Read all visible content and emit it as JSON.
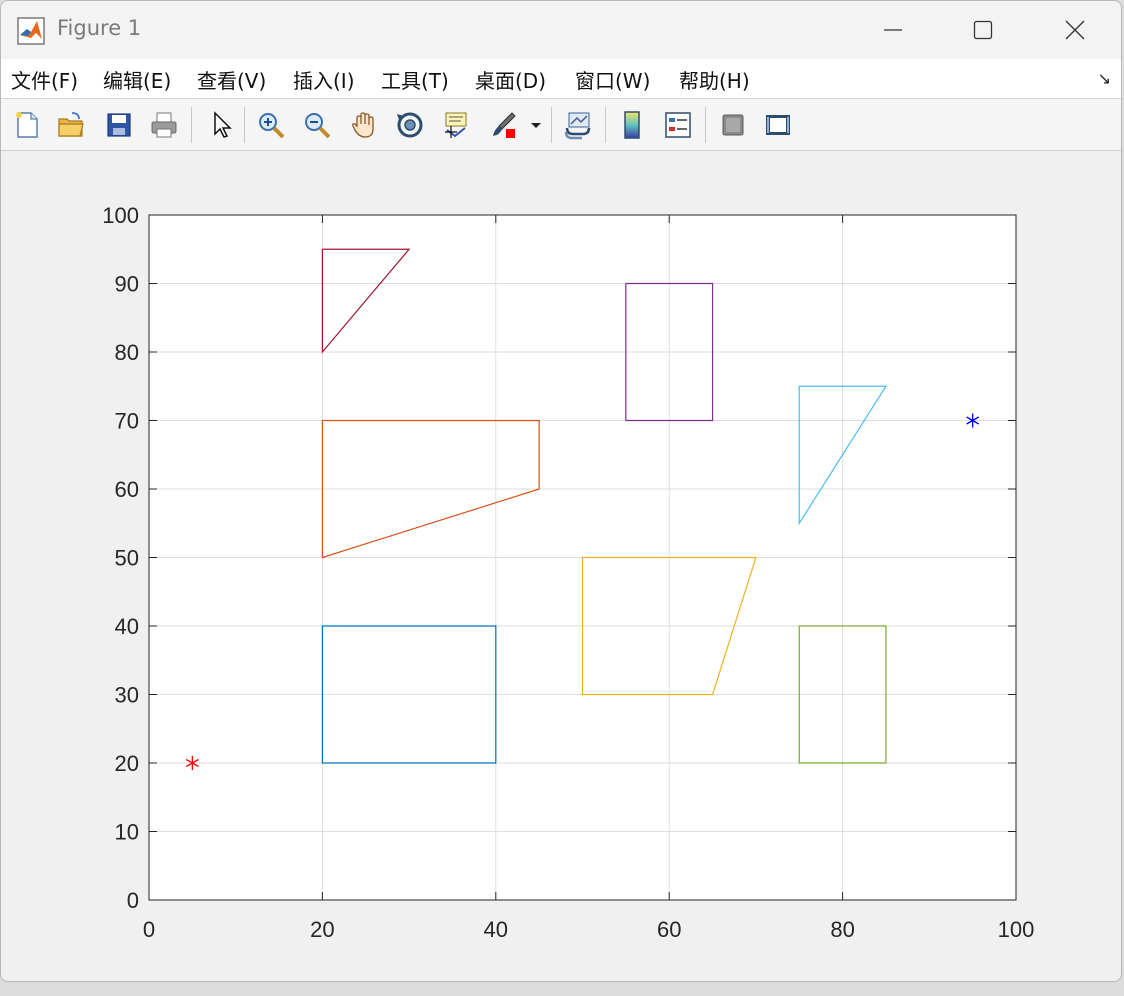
{
  "window": {
    "title": "Figure 1",
    "controls": [
      "minimize",
      "maximize",
      "close"
    ]
  },
  "menu": {
    "items": [
      {
        "label": "文件(F)"
      },
      {
        "label": "编辑(E)"
      },
      {
        "label": "查看(V)"
      },
      {
        "label": "插入(I)"
      },
      {
        "label": "工具(T)"
      },
      {
        "label": "桌面(D)"
      },
      {
        "label": "窗口(W)"
      },
      {
        "label": "帮助(H)"
      }
    ],
    "overflow_icon": "dock-arrow-icon"
  },
  "toolbar": {
    "buttons": [
      {
        "icon": "new-figure-icon"
      },
      {
        "icon": "open-file-icon"
      },
      {
        "icon": "save-icon"
      },
      {
        "icon": "print-icon"
      },
      {
        "icon": "pointer-icon"
      },
      {
        "icon": "zoom-in-icon"
      },
      {
        "icon": "zoom-out-icon"
      },
      {
        "icon": "pan-hand-icon"
      },
      {
        "icon": "rotate-3d-icon"
      },
      {
        "icon": "data-cursor-icon"
      },
      {
        "icon": "brush-icon"
      },
      {
        "icon": "brush-dropdown-icon"
      },
      {
        "icon": "link-plot-icon"
      },
      {
        "icon": "colorbar-icon"
      },
      {
        "icon": "legend-icon"
      },
      {
        "icon": "hide-tools-icon"
      },
      {
        "icon": "show-tools-icon"
      }
    ]
  },
  "chart_data": {
    "type": "line",
    "title": "",
    "xlabel": "",
    "ylabel": "",
    "xlim": [
      0,
      100
    ],
    "ylim": [
      0,
      100
    ],
    "xticks": [
      "0",
      "20",
      "40",
      "60",
      "80",
      "100"
    ],
    "yticks": [
      "0",
      "10",
      "20",
      "30",
      "40",
      "50",
      "60",
      "70",
      "80",
      "90",
      "100"
    ],
    "grid": true,
    "polygons": [
      {
        "color": "#0072BD",
        "points": [
          [
            20,
            20
          ],
          [
            40,
            20
          ],
          [
            40,
            40
          ],
          [
            20,
            40
          ]
        ]
      },
      {
        "color": "#D95319",
        "points": [
          [
            20,
            50
          ],
          [
            45,
            60
          ],
          [
            45,
            70
          ],
          [
            20,
            70
          ]
        ]
      },
      {
        "color": "#A2142F",
        "points": [
          [
            20,
            80
          ],
          [
            30,
            95
          ],
          [
            20,
            95
          ]
        ]
      },
      {
        "color": "#EDB120",
        "points": [
          [
            50,
            30
          ],
          [
            65,
            30
          ],
          [
            70,
            50
          ],
          [
            50,
            50
          ]
        ]
      },
      {
        "color": "#7E2F8E",
        "points": [
          [
            55,
            70
          ],
          [
            65,
            70
          ],
          [
            65,
            90
          ],
          [
            55,
            90
          ]
        ]
      },
      {
        "color": "#77AC30",
        "points": [
          [
            75,
            20
          ],
          [
            85,
            20
          ],
          [
            85,
            40
          ],
          [
            75,
            40
          ]
        ]
      },
      {
        "color": "#4DBEEE",
        "points": [
          [
            75,
            55
          ],
          [
            85,
            75
          ],
          [
            75,
            75
          ]
        ]
      }
    ],
    "markers": [
      {
        "x": 5,
        "y": 20,
        "color": "#FF0000",
        "symbol": "*"
      },
      {
        "x": 95,
        "y": 70,
        "color": "#0000FF",
        "symbol": "*"
      }
    ]
  }
}
